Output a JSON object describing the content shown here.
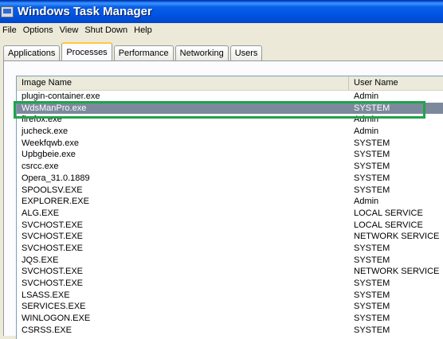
{
  "window": {
    "title": "Windows Task Manager"
  },
  "menu": {
    "items": [
      "File",
      "Options",
      "View",
      "Shut Down",
      "Help"
    ]
  },
  "tabs": [
    {
      "label": "Applications",
      "active": false
    },
    {
      "label": "Processes",
      "active": true
    },
    {
      "label": "Performance",
      "active": false
    },
    {
      "label": "Networking",
      "active": false
    },
    {
      "label": "Users",
      "active": false
    }
  ],
  "table": {
    "columns": [
      "Image Name",
      "User Name"
    ],
    "rows": [
      {
        "name": "plugin-container.exe",
        "user": "Admin"
      },
      {
        "name": "WdsManPro.exe",
        "user": "SYSTEM",
        "selected": true
      },
      {
        "name": "firefox.exe",
        "user": "Admin"
      },
      {
        "name": "jucheck.exe",
        "user": "Admin"
      },
      {
        "name": "Weekfqwb.exe",
        "user": "SYSTEM"
      },
      {
        "name": "Upbgbeie.exe",
        "user": "SYSTEM"
      },
      {
        "name": "csrcc.exe",
        "user": "SYSTEM"
      },
      {
        "name": "Opera_31.0.1889",
        "user": "SYSTEM"
      },
      {
        "name": "SPOOLSV.EXE",
        "user": "SYSTEM"
      },
      {
        "name": "EXPLORER.EXE",
        "user": "Admin"
      },
      {
        "name": "ALG.EXE",
        "user": "LOCAL SERVICE"
      },
      {
        "name": "SVCHOST.EXE",
        "user": "LOCAL SERVICE"
      },
      {
        "name": "SVCHOST.EXE",
        "user": "NETWORK SERVICE"
      },
      {
        "name": "SVCHOST.EXE",
        "user": "SYSTEM"
      },
      {
        "name": "JQS.EXE",
        "user": "SYSTEM"
      },
      {
        "name": "SVCHOST.EXE",
        "user": "NETWORK SERVICE"
      },
      {
        "name": "SVCHOST.EXE",
        "user": "SYSTEM"
      },
      {
        "name": "LSASS.EXE",
        "user": "SYSTEM"
      },
      {
        "name": "SERVICES.EXE",
        "user": "SYSTEM"
      },
      {
        "name": "WINLOGON.EXE",
        "user": "SYSTEM"
      },
      {
        "name": "CSRSS.EXE",
        "user": "SYSTEM"
      }
    ]
  },
  "colors": {
    "selection": "#7c899c",
    "highlight_box": "#1ea44a",
    "active_tab_accent": "#ffc83c"
  }
}
